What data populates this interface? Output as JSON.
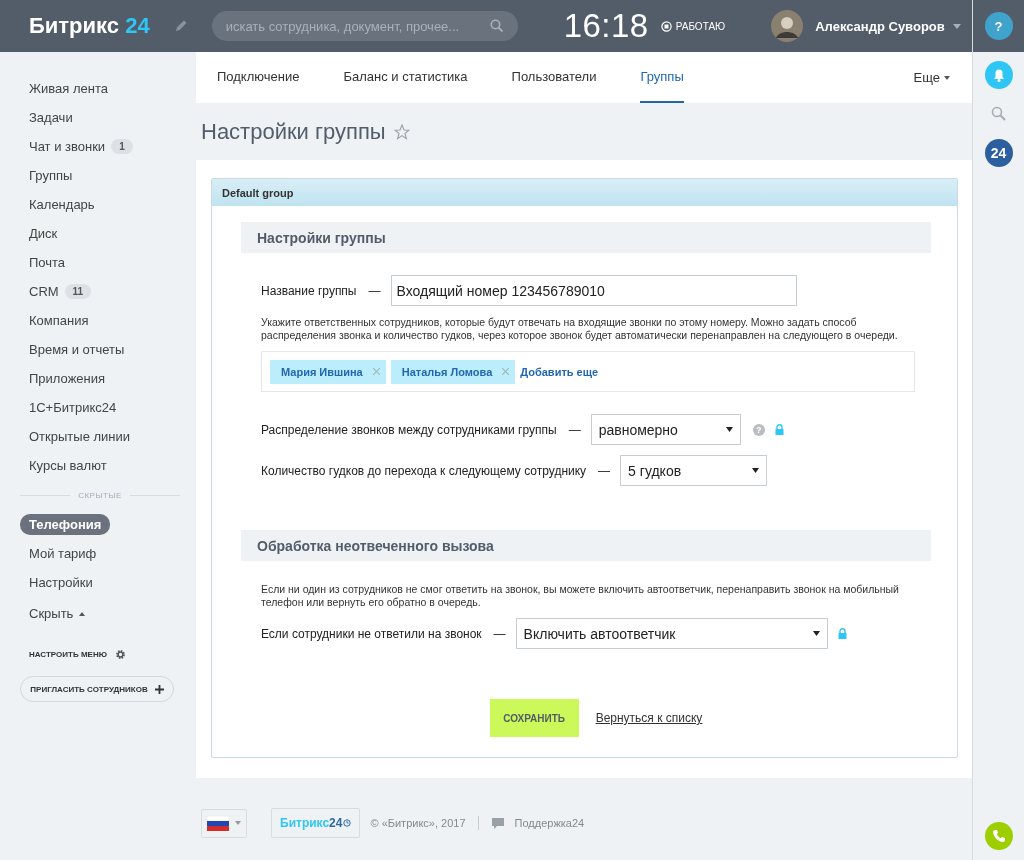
{
  "header": {
    "logo": {
      "name": "Битрикс",
      "number": "24"
    },
    "search": {
      "placeholder": "искать сотрудника, документ, прочее..."
    },
    "time": "16:18",
    "work_status": "РАБОТАЮ",
    "user": {
      "name": "Александр Суворов"
    }
  },
  "right_rail": {
    "help": "?",
    "badge": "24"
  },
  "sidebar": {
    "items": [
      {
        "label": "Живая лента"
      },
      {
        "label": "Задачи"
      },
      {
        "label": "Чат и звонки",
        "counter": "1"
      },
      {
        "label": "Группы"
      },
      {
        "label": "Календарь"
      },
      {
        "label": "Диск"
      },
      {
        "label": "Почта"
      },
      {
        "label": "CRM",
        "counter": "11"
      },
      {
        "label": "Компания"
      },
      {
        "label": "Время и отчеты"
      },
      {
        "label": "Приложения"
      },
      {
        "label": "1С+Битрикс24"
      },
      {
        "label": "Открытые линии"
      },
      {
        "label": "Курсы валют"
      }
    ],
    "hidden_label": "СКРЫТЫЕ",
    "hidden_items": [
      {
        "label": "Телефония",
        "selected": true
      },
      {
        "label": "Мой тариф",
        "selected": false
      },
      {
        "label": "Настройки",
        "selected": false
      }
    ],
    "toggle": "Скрыть",
    "configure_menu": "НАСТРОИТЬ МЕНЮ",
    "invite_button": "ПРИГЛАСИТЬ СОТРУДНИКОВ"
  },
  "tabs": [
    {
      "label": "Подключение",
      "selected": false
    },
    {
      "label": "Баланс и статистика",
      "selected": false
    },
    {
      "label": "Пользователи",
      "selected": false
    },
    {
      "label": "Группы",
      "selected": true
    }
  ],
  "more_tab": "Еще",
  "page_title": "Настройки группы",
  "card": {
    "title": "Default group",
    "sections": [
      {
        "title": "Настройки группы",
        "fields": [
          {
            "kind": "text",
            "label": "Название группы",
            "dash": "—",
            "value": "Входящий номер 123456789010"
          },
          {
            "kind": "note",
            "text": "Укажите ответственных сотрудников, которые будут отвечать на входящие звонки по этому номеру. Можно задать способ распределения звонка и количество гудков, через которое звонок будет автоматически перенаправлен на следующего в очереди."
          },
          {
            "kind": "users",
            "tags": [
              "Мария Ившина",
              "Наталья Ломова"
            ],
            "add_link": "Добавить еще"
          },
          {
            "kind": "select",
            "label": "Распределение звонков между сотрудниками группы",
            "dash": "—",
            "value": "равномерно",
            "help": "?",
            "locked": true
          },
          {
            "kind": "select",
            "label": "Количество гудков до перехода к следующему сотруднику",
            "dash": "—",
            "value": "5 гудков"
          }
        ]
      },
      {
        "title": "Обработка неотвеченного вызова",
        "fields": [
          {
            "kind": "note",
            "text": "Если ни один из сотрудников не смог ответить на звонок, вы можете включить автоответчик, перенаправить звонок на мобильный телефон или вернуть его обратно в очередь."
          },
          {
            "kind": "select",
            "label": "Если сотрудники не ответили на звонок",
            "dash": "—",
            "value": "Включить автоответчик",
            "locked": true
          }
        ]
      }
    ],
    "save_button": "СОХРАНИТЬ",
    "back_link": "Вернуться к списку"
  },
  "footer": {
    "logo": {
      "name": "Битрикс",
      "number": "24"
    },
    "copyright": "© «Битрикс», 2017",
    "support": "Поддержка24"
  }
}
